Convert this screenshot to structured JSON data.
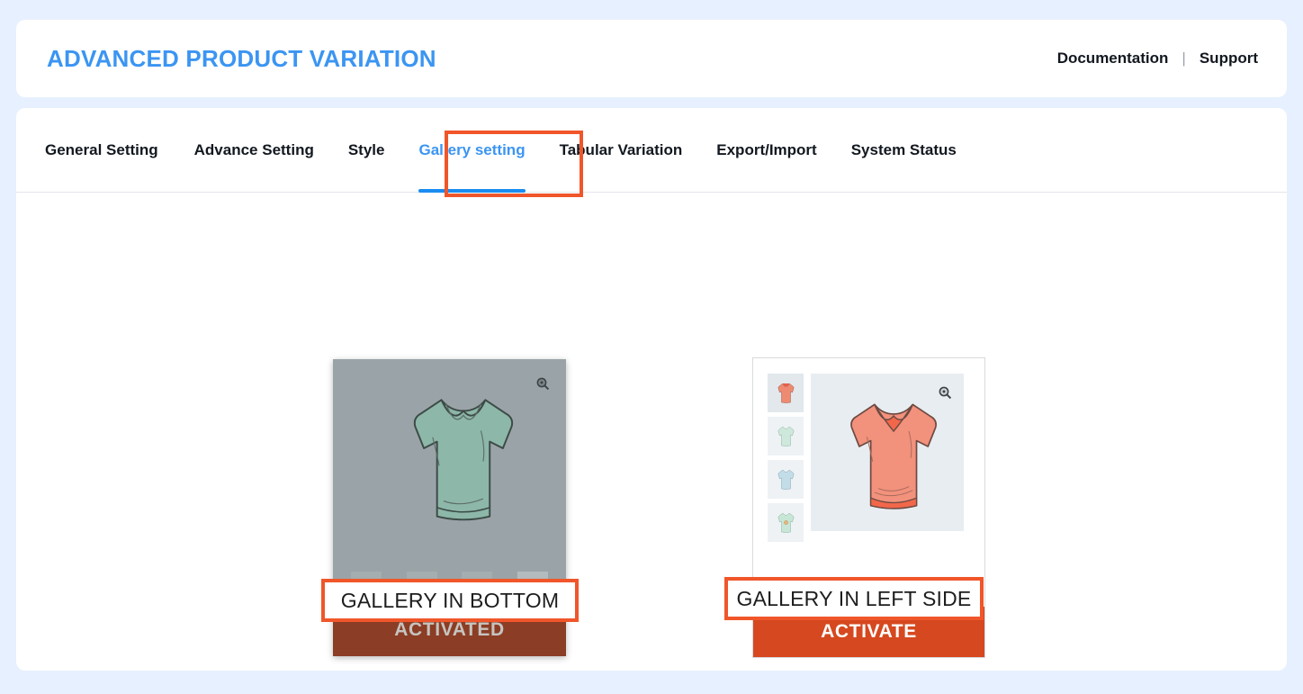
{
  "header": {
    "title": "ADVANCED PRODUCT VARIATION",
    "links": [
      {
        "label": "Documentation",
        "name": "documentation-link"
      },
      {
        "label": "Support",
        "name": "support-link"
      }
    ],
    "separator": "|"
  },
  "tabs": [
    {
      "label": "General Setting",
      "active": false
    },
    {
      "label": "Advance Setting",
      "active": false
    },
    {
      "label": "Style",
      "active": false
    },
    {
      "label": "Gallery setting",
      "active": true
    },
    {
      "label": "Tabular Variation",
      "active": false
    },
    {
      "label": "Export/Import",
      "active": false
    },
    {
      "label": "System Status",
      "active": false
    }
  ],
  "gallery_options": [
    {
      "caption": "GALLERY IN BOTTOM",
      "button_label": "ACTIVATED",
      "state": "activated",
      "layout": "bottom",
      "zoom_icon": "magnifier-icon",
      "main_shirt_color": "#8cb7a9",
      "thumbnails": [
        {
          "color": "#a9c4ce",
          "selected": false
        },
        {
          "color": "#a9cec3",
          "selected": false
        },
        {
          "color": "#a9c7d2",
          "selected": false
        },
        {
          "color": "#9cc7ba",
          "selected": true
        }
      ]
    },
    {
      "caption": "GALLERY IN LEFT SIDE",
      "button_label": "ACTIVATE",
      "state": "inactive",
      "layout": "left",
      "zoom_icon": "magnifier-icon",
      "main_shirt_color": "#f2917c",
      "thumbnails": [
        {
          "color": "#ef8a72",
          "selected": true
        },
        {
          "color": "#cfe8dc",
          "selected": false
        },
        {
          "color": "#c3dde8",
          "selected": false
        },
        {
          "color": "#c8e6d6",
          "selected": false
        }
      ]
    }
  ],
  "colors": {
    "accent_blue": "#3b95f2",
    "tab_underline": "#1a8cf0",
    "annotation_orange": "#f0562a",
    "activate_orange": "#d6481f",
    "activated_muted": "#8b3d25",
    "page_background": "#e7f0fe"
  }
}
